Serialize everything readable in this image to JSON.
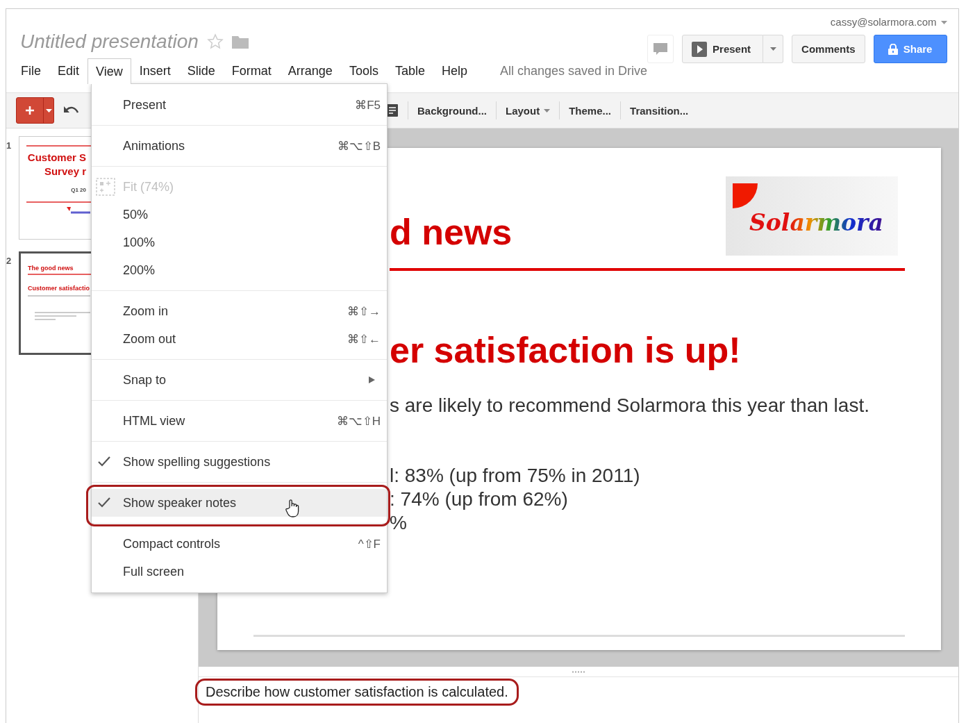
{
  "header": {
    "title": "Untitled presentation",
    "account": "cassy@solarmora.com",
    "menus": [
      {
        "label": "File",
        "selected": false
      },
      {
        "label": "Edit",
        "selected": false
      },
      {
        "label": "View",
        "selected": true
      },
      {
        "label": "Insert",
        "selected": false
      },
      {
        "label": "Slide",
        "selected": false
      },
      {
        "label": "Format",
        "selected": false
      },
      {
        "label": "Arrange",
        "selected": false
      },
      {
        "label": "Tools",
        "selected": false
      },
      {
        "label": "Table",
        "selected": false
      },
      {
        "label": "Help",
        "selected": false
      }
    ],
    "save_status": "All changes saved in Drive",
    "buttons": {
      "present": "Present",
      "comments": "Comments",
      "share": "Share"
    }
  },
  "toolbar": {
    "items": [
      {
        "label": "Background...",
        "dropdown": false
      },
      {
        "label": "Layout",
        "dropdown": true
      },
      {
        "label": "Theme...",
        "dropdown": false
      },
      {
        "label": "Transition...",
        "dropdown": false
      }
    ]
  },
  "filmstrip": [
    {
      "number": "1",
      "selected": false,
      "kind": "title",
      "lines": [
        "Customer S",
        "Survey r"
      ],
      "subtitle": "Q1 20"
    },
    {
      "number": "2",
      "selected": true,
      "kind": "content",
      "lines": [
        "The good news"
      ],
      "subtitle": "Customer satisfactio"
    }
  ],
  "slide": {
    "title": "d news",
    "logo": "Solarmora",
    "heading": "er satisfaction is up!",
    "body": "s are likely to recommend Solarmora this year than last.",
    "bullets": [
      "l: 83% (up from 75% in 2011)",
      ": 74% (up from 62%)",
      "%"
    ]
  },
  "notes": {
    "text": "Describe how customer satisfaction is calculated.",
    "annotated": true
  },
  "view_menu": [
    {
      "kind": "item",
      "label": "Present",
      "shortcut": "⌘F5",
      "checked": false,
      "disabled": false,
      "highlighted": false,
      "submenu": false,
      "annotated": false
    },
    {
      "kind": "separator"
    },
    {
      "kind": "item",
      "label": "Animations",
      "shortcut": "⌘⌥⇧B",
      "checked": false,
      "disabled": false,
      "highlighted": false,
      "submenu": false,
      "annotated": false
    },
    {
      "kind": "separator"
    },
    {
      "kind": "fit",
      "label": "Fit (74%)",
      "checked": false,
      "disabled": true,
      "highlighted": false,
      "submenu": false,
      "annotated": false
    },
    {
      "kind": "item",
      "label": "50%",
      "checked": false,
      "disabled": false,
      "highlighted": false,
      "submenu": false,
      "annotated": false
    },
    {
      "kind": "item",
      "label": "100%",
      "checked": false,
      "disabled": false,
      "highlighted": false,
      "submenu": false,
      "annotated": false
    },
    {
      "kind": "item",
      "label": "200%",
      "checked": false,
      "disabled": false,
      "highlighted": false,
      "submenu": false,
      "annotated": false
    },
    {
      "kind": "separator"
    },
    {
      "kind": "item",
      "label": "Zoom in",
      "shortcut": "⌘⇧→",
      "checked": false,
      "disabled": false,
      "highlighted": false,
      "submenu": false,
      "annotated": false
    },
    {
      "kind": "item",
      "label": "Zoom out",
      "shortcut": "⌘⇧←",
      "checked": false,
      "disabled": false,
      "highlighted": false,
      "submenu": false,
      "annotated": false
    },
    {
      "kind": "separator"
    },
    {
      "kind": "item",
      "label": "Snap to",
      "checked": false,
      "disabled": false,
      "highlighted": false,
      "submenu": true,
      "annotated": false
    },
    {
      "kind": "separator"
    },
    {
      "kind": "item",
      "label": "HTML view",
      "shortcut": "⌘⌥⇧H",
      "checked": false,
      "disabled": false,
      "highlighted": false,
      "submenu": false,
      "annotated": false
    },
    {
      "kind": "separator"
    },
    {
      "kind": "item",
      "label": "Show spelling suggestions",
      "checked": true,
      "disabled": false,
      "highlighted": false,
      "submenu": false,
      "annotated": false
    },
    {
      "kind": "separator"
    },
    {
      "kind": "item",
      "label": "Show speaker notes",
      "checked": true,
      "disabled": false,
      "highlighted": true,
      "submenu": false,
      "annotated": true
    },
    {
      "kind": "separator"
    },
    {
      "kind": "item",
      "label": "Compact controls",
      "shortcut": "^⇧F",
      "checked": false,
      "disabled": false,
      "highlighted": false,
      "submenu": false,
      "annotated": false
    },
    {
      "kind": "item",
      "label": "Full screen",
      "checked": false,
      "disabled": false,
      "highlighted": false,
      "submenu": false,
      "annotated": false
    }
  ]
}
